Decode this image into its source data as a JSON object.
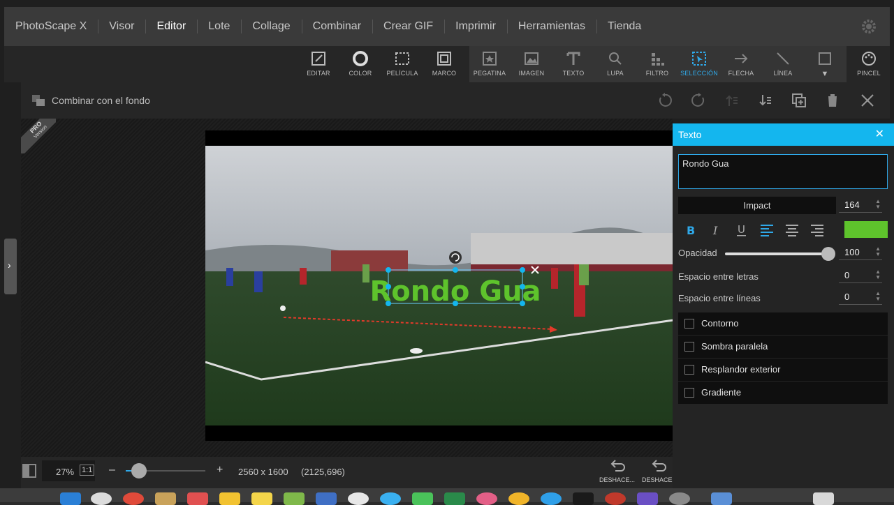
{
  "nav": {
    "items": [
      "PhotoScape X",
      "Visor",
      "Editor",
      "Lote",
      "Collage",
      "Combinar",
      "Crear GIF",
      "Imprimir",
      "Herramientas",
      "Tienda"
    ],
    "active": "Editor"
  },
  "tools": {
    "editar": "EDITAR",
    "color": "COLOR",
    "pelicula": "PELÍCULA",
    "marco": "MARCO",
    "pegatina": "PEGATINA",
    "imagen": "IMAGEN",
    "texto": "TEXTO",
    "lupa": "LUPA",
    "filtro": "FILTRO",
    "seleccion": "SELECCIÓN",
    "flecha": "FLECHA",
    "linea": "LÍNEA",
    "more": "▼",
    "pincel": "PINCEL",
    "active": "SELECCIÓN",
    "accent": "#2fa8e8"
  },
  "subbar": {
    "label": "Combinar con el fondo"
  },
  "pro_badge": {
    "line1": "PRO",
    "line2": "Version"
  },
  "canvas": {
    "overlay_text": "Rondo Gua",
    "overlay_color": "#5ec32c"
  },
  "panel": {
    "title": "Texto",
    "text_value": "Rondo Gua",
    "font": "Impact",
    "size": "164",
    "color": "#5ec32c",
    "opacity_label": "Opacidad",
    "opacity": "100",
    "opacity_level": 1.0,
    "letter_spacing_label": "Espacio entre letras",
    "letter_spacing": "0",
    "line_spacing_label": "Espacio entre líneas",
    "line_spacing": "0",
    "options": [
      "Contorno",
      "Sombra paralela",
      "Resplandor exterior",
      "Gradiente"
    ]
  },
  "bottombar": {
    "zoom": "27%",
    "one_to_one": "1:1",
    "minus": "–",
    "plus": "+",
    "dimensions": "2560 x 1600",
    "coords": "(2125,696)",
    "undo1": "DESHACE...",
    "undo2": "DESHACE..."
  }
}
